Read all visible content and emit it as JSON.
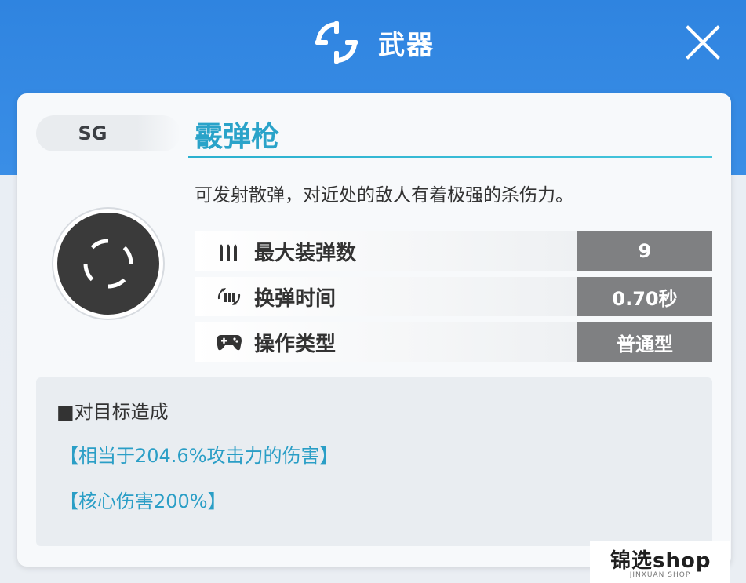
{
  "header": {
    "title": "武器",
    "icon": "crosshair-icon",
    "close_icon": "close-icon"
  },
  "weapon": {
    "type_badge": "SG",
    "name": "霰弹枪",
    "description": "可发射散弹，对近处的敌人有着极强的杀伤力。",
    "emblem_icon": "target-reticle-icon"
  },
  "stats": [
    {
      "icon": "ammo-bullets-icon",
      "label": "最大装弹数",
      "value": "9"
    },
    {
      "icon": "reload-icon",
      "label": "换弹时间",
      "value": "0.70秒"
    },
    {
      "icon": "gamepad-icon",
      "label": "操作类型",
      "value": "普通型"
    }
  ],
  "effects": {
    "heading": "■对目标造成",
    "lines": [
      "【相当于204.6%攻击力的伤害】",
      "【核心伤害200%】"
    ]
  },
  "watermark": {
    "main": "锦选shop",
    "sub": "JINXUAN SHOP"
  },
  "colors": {
    "header_blue": "#2f84e0",
    "accent_cyan": "#2aa3c9",
    "value_bg": "#7f8082"
  }
}
